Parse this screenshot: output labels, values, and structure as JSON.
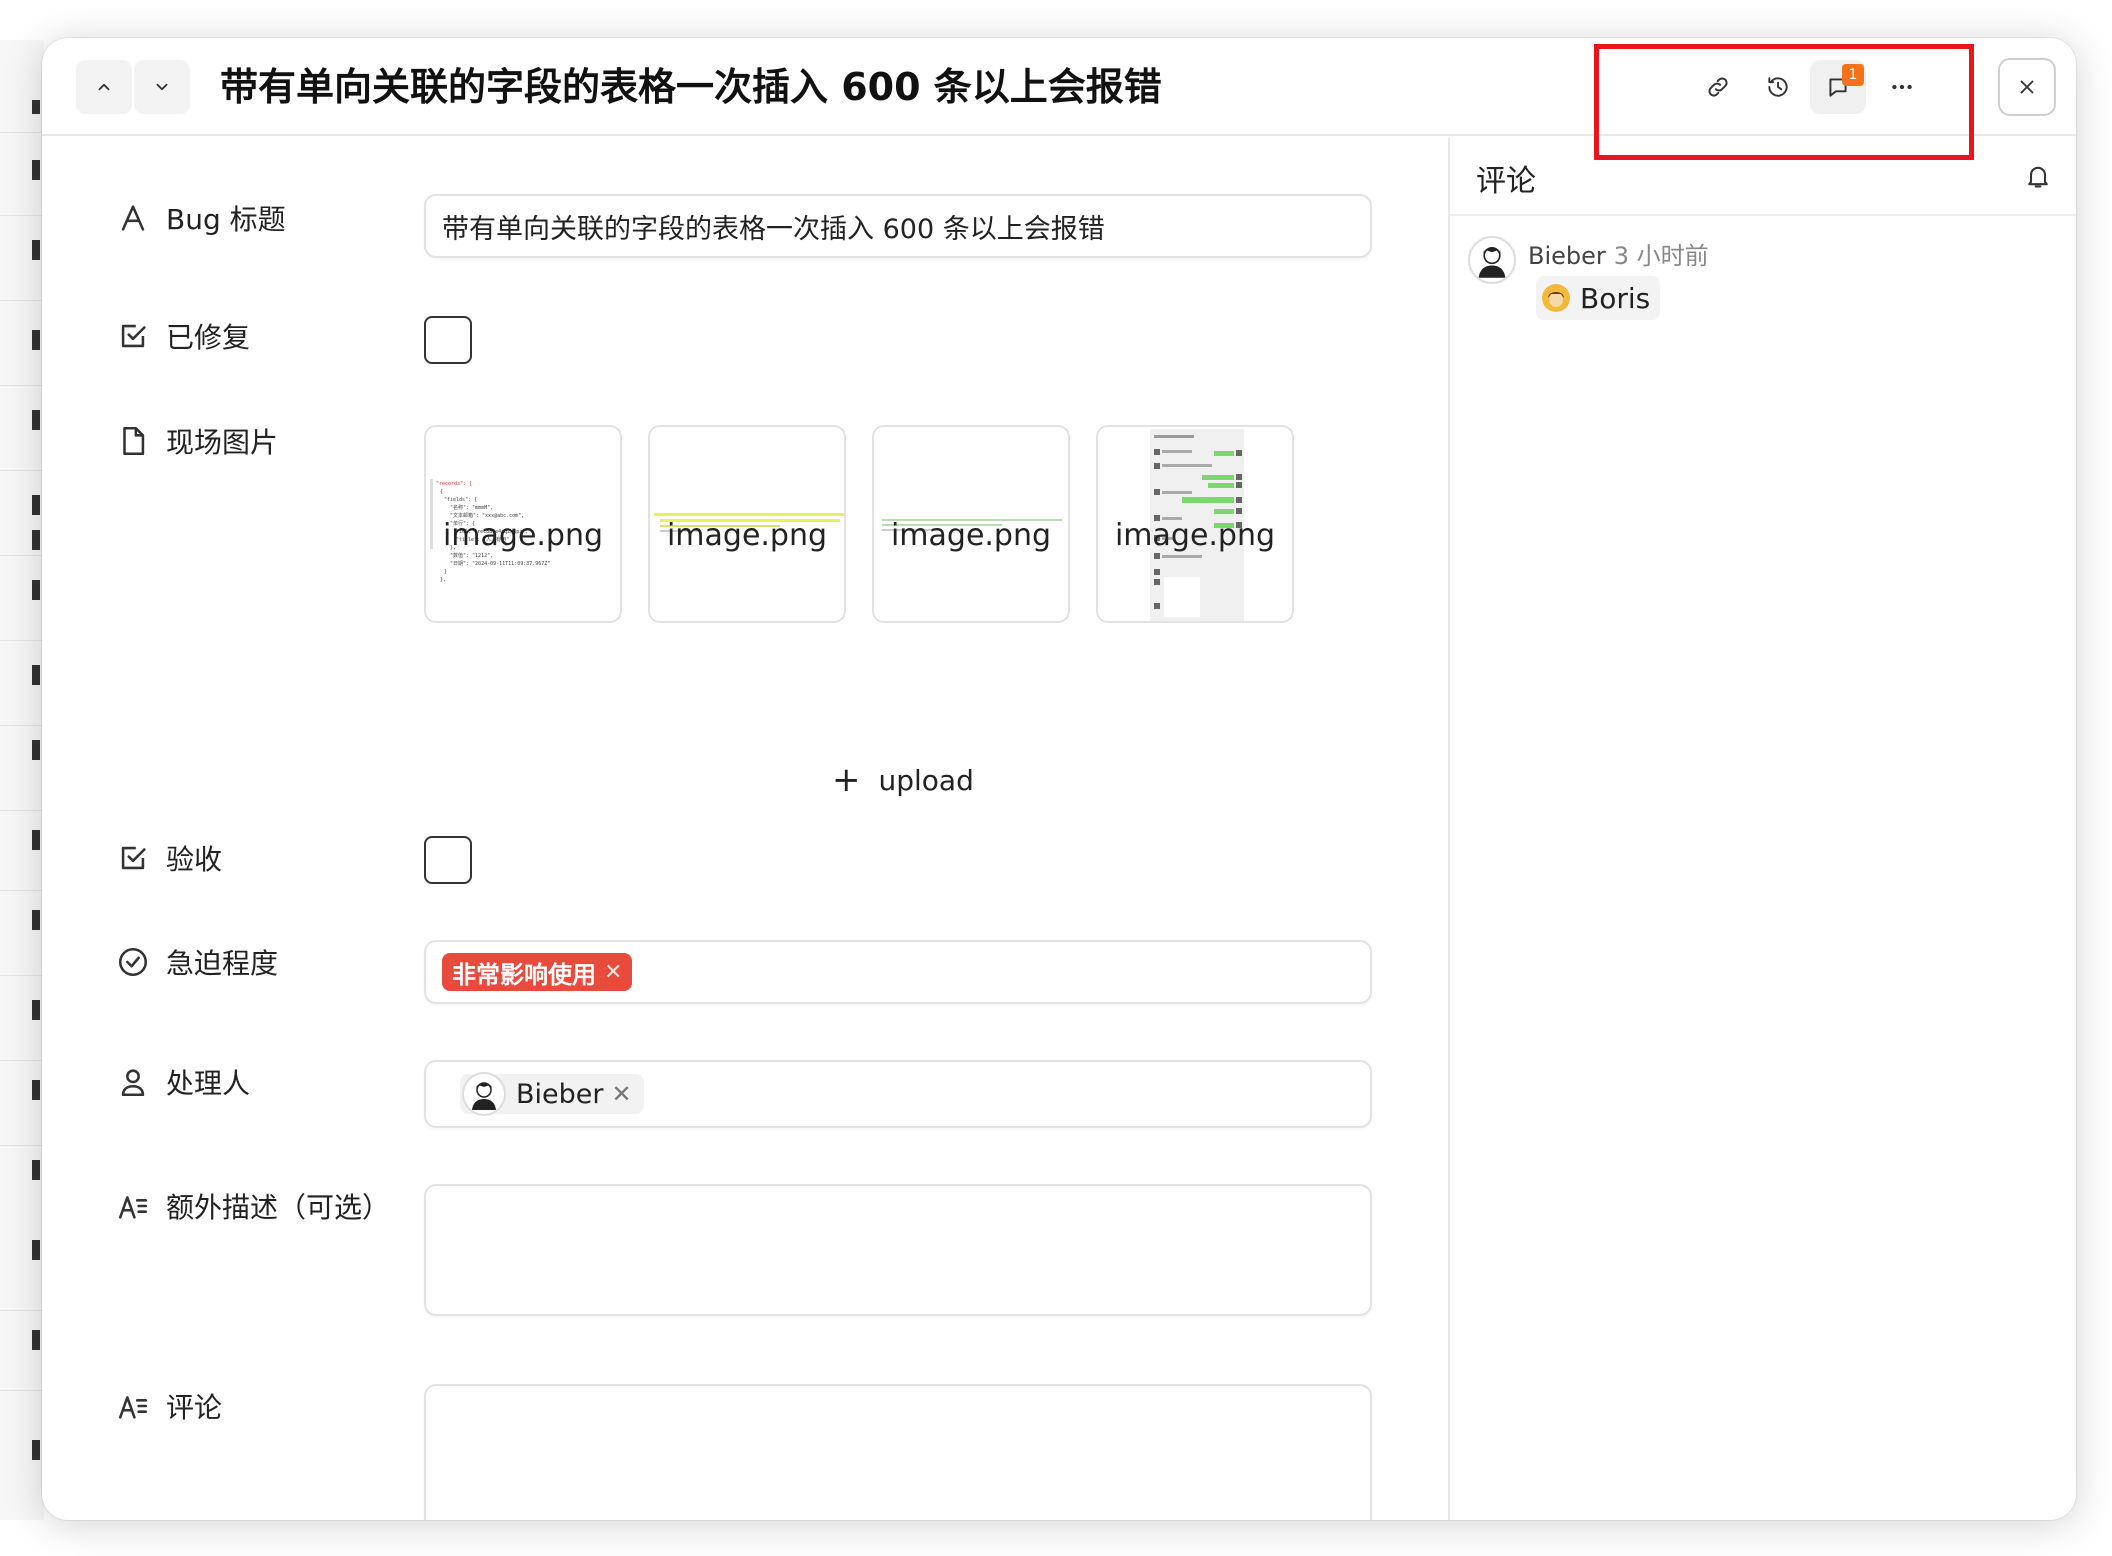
{
  "header": {
    "title": "带有单向关联的字段的表格一次插入 600 条以上会报错",
    "badge_count": "1"
  },
  "form": {
    "title_field": {
      "label": "Bug 标题",
      "value": "带有单向关联的字段的表格一次插入 600 条以上会报错"
    },
    "fixed_field": {
      "label": "已修复",
      "checked": false
    },
    "images_field": {
      "label": "现场图片",
      "files": [
        "image.png",
        "image.png",
        "image.png",
        "image.png"
      ],
      "upload_label": "upload"
    },
    "accept_field": {
      "label": "验收",
      "checked": false
    },
    "urgency_field": {
      "label": "急迫程度",
      "value": "非常影响使用",
      "color": "#e84a3c"
    },
    "assignee_field": {
      "label": "处理人",
      "value": "Bieber"
    },
    "extra_field": {
      "label": "额外描述（可选）",
      "value": ""
    },
    "comment_field": {
      "label": "评论",
      "value": ""
    }
  },
  "comments": {
    "title": "评论",
    "items": [
      {
        "author": "Bieber",
        "time": "3 小时前",
        "mention": "Boris"
      }
    ]
  },
  "colors": {
    "highlight": "#e8161b",
    "badge": "#f5711a",
    "urgent_tag": "#e84a3c"
  }
}
